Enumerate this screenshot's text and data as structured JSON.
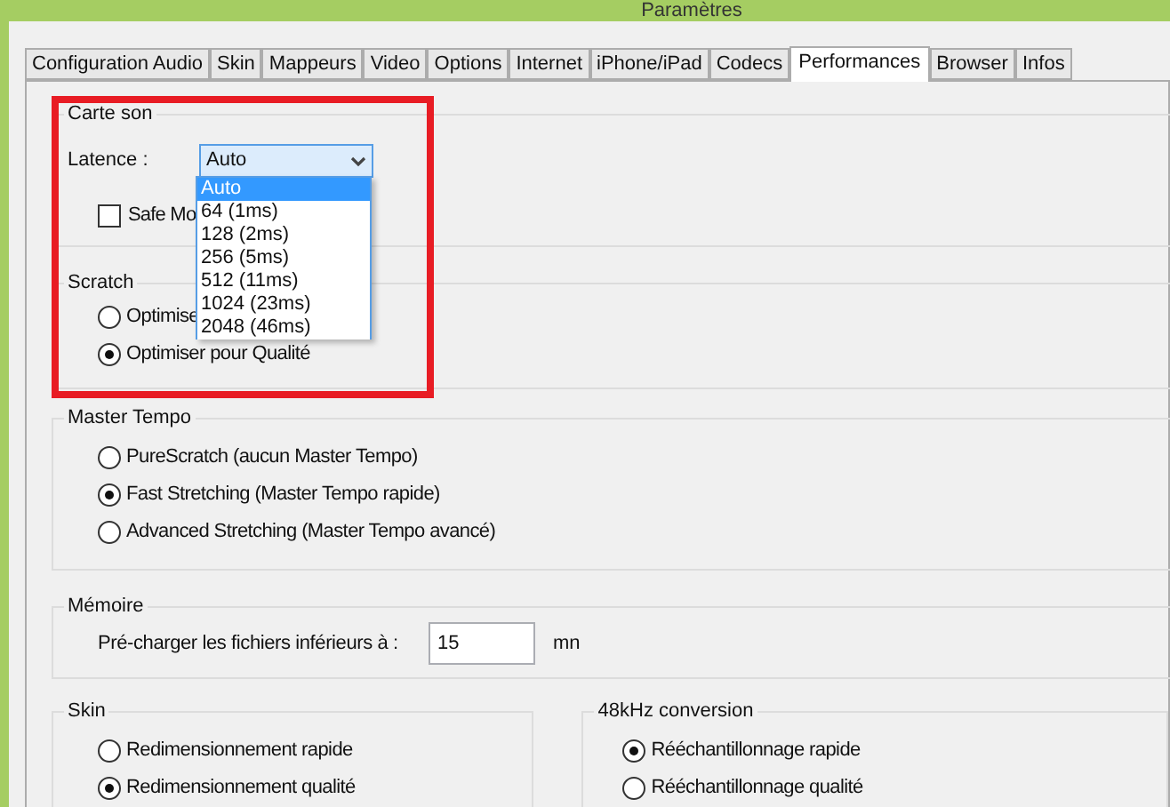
{
  "window": {
    "title": "Paramètres"
  },
  "tabs": [
    {
      "label": "Configuration Audio",
      "selected": false
    },
    {
      "label": "Skin",
      "selected": false
    },
    {
      "label": "Mappeurs",
      "selected": false
    },
    {
      "label": "Video",
      "selected": false
    },
    {
      "label": "Options",
      "selected": false
    },
    {
      "label": "Internet",
      "selected": false
    },
    {
      "label": "iPhone/iPad",
      "selected": false
    },
    {
      "label": "Codecs",
      "selected": false
    },
    {
      "label": "Performances",
      "selected": true
    },
    {
      "label": "Browser",
      "selected": false
    },
    {
      "label": "Infos",
      "selected": false
    }
  ],
  "sound_card": {
    "title": "Carte son",
    "latency_label": "Latence :",
    "latency_value": "Auto",
    "dropdown_options": [
      {
        "label": "Auto",
        "selected": true
      },
      {
        "label": "64 (1ms)",
        "selected": false
      },
      {
        "label": "128 (2ms)",
        "selected": false
      },
      {
        "label": "256 (5ms)",
        "selected": false
      },
      {
        "label": "512 (11ms)",
        "selected": false
      },
      {
        "label": "1024 (23ms)",
        "selected": false
      },
      {
        "label": "2048 (46ms)",
        "selected": false
      }
    ],
    "safe_mode": {
      "label": "Safe Mo",
      "checked": false
    }
  },
  "scratch": {
    "title": "Scratch",
    "options": [
      {
        "label": "Optimise",
        "selected": false
      },
      {
        "label": "Optimiser pour Qualité",
        "selected": true
      }
    ]
  },
  "master_tempo": {
    "title": "Master Tempo",
    "options": [
      {
        "label": "PureScratch (aucun Master Tempo)",
        "selected": false
      },
      {
        "label": "Fast Stretching (Master Tempo rapide)",
        "selected": true
      },
      {
        "label": "Advanced Stretching (Master Tempo avancé)",
        "selected": false
      }
    ]
  },
  "memory": {
    "title": "Mémoire",
    "label": "Pré-charger les fichiers inférieurs à :",
    "value": "15",
    "unit": "mn"
  },
  "skin": {
    "title": "Skin",
    "options": [
      {
        "label": "Redimensionnement rapide",
        "selected": false
      },
      {
        "label": "Redimensionnement qualité",
        "selected": true
      }
    ]
  },
  "conversion": {
    "title": "48kHz conversion",
    "options": [
      {
        "label": "Rééchantillonnage rapide",
        "selected": true
      },
      {
        "label": "Rééchantillonnage qualité",
        "selected": false
      }
    ]
  }
}
